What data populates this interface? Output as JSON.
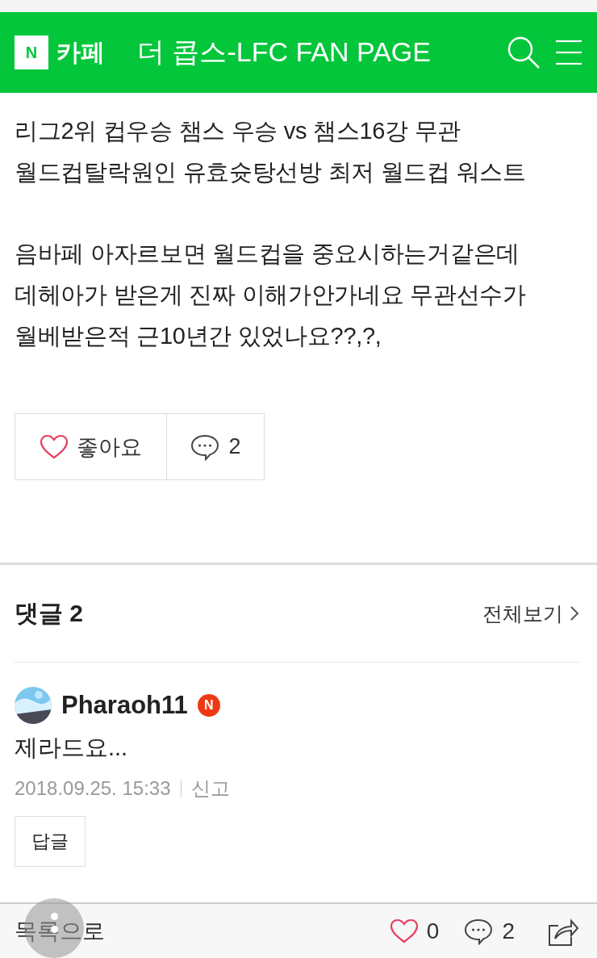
{
  "header": {
    "logo_mark": "N",
    "logo_text": "카페",
    "cafe_name": "더 콥스-LFC FAN PAGE"
  },
  "post": {
    "paragraphs": [
      "리그2위 컵우승 챔스 우승 vs 챔스16강 무관 월드컵탈락원인 유효슛탕선방 최저 월드컵 워스트",
      "음바페 아자르보면 월드컵을 중요시하는거같은데 데헤아가 받은게 진짜 이해가안가네요 무관선수가 월베받은적 근10년간 있었나요??,?,"
    ],
    "like_label": "좋아요",
    "liked": false,
    "comment_count": "2"
  },
  "comments_section": {
    "title": "댓글",
    "count": "2",
    "view_all": "전체보기"
  },
  "comments": [
    {
      "author": "Pharaoh11",
      "badge": "N",
      "text": "제라드요...",
      "date": "2018.09.25. 15:33",
      "report": "신고",
      "reply": "답글"
    }
  ],
  "bottom_bar": {
    "list": "목록으로",
    "likes": "0",
    "liked": false,
    "comments": "2"
  }
}
